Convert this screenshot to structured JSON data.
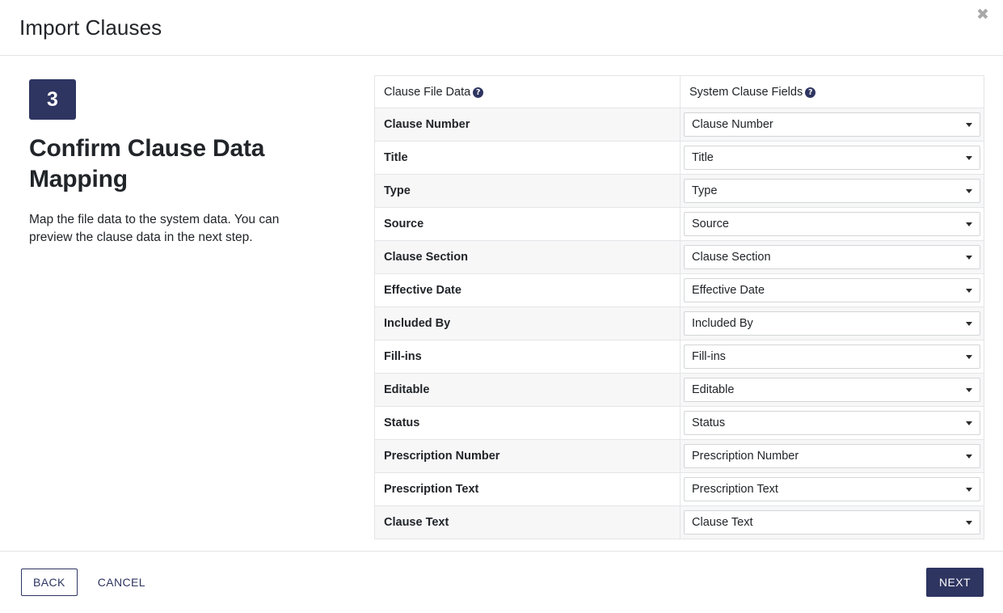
{
  "modal": {
    "title": "Import Clauses",
    "close_icon": "close-icon",
    "close_glyph": "✖"
  },
  "step": {
    "number": "3",
    "heading": "Confirm Clause Data Mapping",
    "description": "Map the file data to the system data. You can preview the clause data in the next step."
  },
  "table": {
    "headers": {
      "left": "Clause File Data",
      "right": "System Clause Fields",
      "help_glyph": "?",
      "help_icon_name": "help-icon"
    },
    "rows": [
      {
        "file_field": "Clause Number",
        "system_field": "Clause Number"
      },
      {
        "file_field": "Title",
        "system_field": "Title"
      },
      {
        "file_field": "Type",
        "system_field": "Type"
      },
      {
        "file_field": "Source",
        "system_field": "Source"
      },
      {
        "file_field": "Clause Section",
        "system_field": "Clause Section"
      },
      {
        "file_field": "Effective Date",
        "system_field": "Effective Date"
      },
      {
        "file_field": "Included By",
        "system_field": "Included By"
      },
      {
        "file_field": "Fill-ins",
        "system_field": "Fill-ins"
      },
      {
        "file_field": "Editable",
        "system_field": "Editable"
      },
      {
        "file_field": "Status",
        "system_field": "Status"
      },
      {
        "file_field": "Prescription Number",
        "system_field": "Prescription Number"
      },
      {
        "file_field": "Prescription Text",
        "system_field": "Prescription Text"
      },
      {
        "file_field": "Clause Text",
        "system_field": "Clause Text"
      }
    ]
  },
  "footer": {
    "back_label": "BACK",
    "cancel_label": "CANCEL",
    "next_label": "NEXT"
  },
  "colors": {
    "brand_navy": "#2e3561",
    "row_stripe": "#f7f7f8",
    "border": "#e4e5e7",
    "close_gray": "#a8a8a8"
  }
}
